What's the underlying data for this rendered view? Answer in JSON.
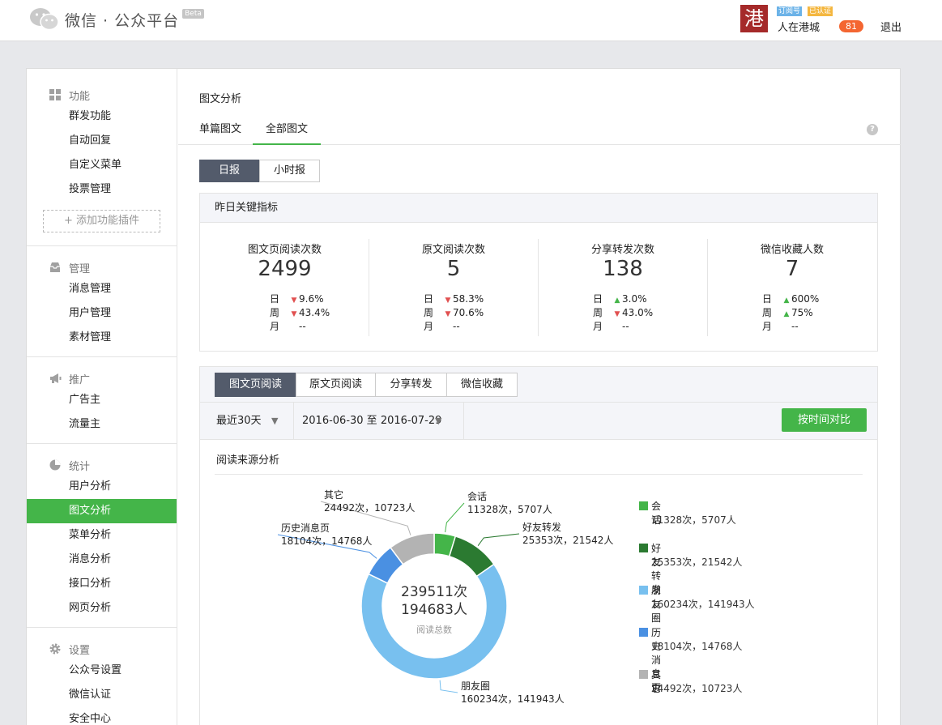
{
  "header": {
    "logo_text": "微信 · 公众平台",
    "beta": "Beta",
    "avatar_char": "港",
    "tag_subscription": "订阅号",
    "tag_certified": "已认证",
    "account_name": "人在港城",
    "notify_count": "81",
    "logout": "退出"
  },
  "sidebar": {
    "groups": [
      {
        "title": "功能",
        "icon": "grid-icon",
        "items": [
          "群发功能",
          "自动回复",
          "自定义菜单",
          "投票管理"
        ],
        "add_plugin": "+ 添加功能插件"
      },
      {
        "title": "管理",
        "icon": "inbox-icon",
        "items": [
          "消息管理",
          "用户管理",
          "素材管理"
        ]
      },
      {
        "title": "推广",
        "icon": "megaphone-icon",
        "items": [
          "广告主",
          "流量主"
        ]
      },
      {
        "title": "统计",
        "icon": "pie-icon",
        "items": [
          "用户分析",
          "图文分析",
          "菜单分析",
          "消息分析",
          "接口分析",
          "网页分析"
        ],
        "active_index": 1
      },
      {
        "title": "设置",
        "icon": "gear-icon",
        "items": [
          "公众号设置",
          "微信认证",
          "安全中心"
        ]
      }
    ]
  },
  "main": {
    "title": "图文分析",
    "tabs": [
      "单篇图文",
      "全部图文"
    ],
    "active_tab": 1,
    "report_types": [
      "日报",
      "小时报"
    ],
    "key_metrics": {
      "title": "昨日关键指标",
      "row_labels": [
        "日",
        "周",
        "月"
      ],
      "columns": [
        {
          "label": "图文页阅读次数",
          "value": "2499",
          "day": "9.6%",
          "day_dir": "down",
          "week": "43.4%",
          "week_dir": "down",
          "month": "--"
        },
        {
          "label": "原文阅读次数",
          "value": "5",
          "day": "58.3%",
          "day_dir": "down",
          "week": "70.6%",
          "week_dir": "down",
          "month": "--"
        },
        {
          "label": "分享转发次数",
          "value": "138",
          "day": "3.0%",
          "day_dir": "up",
          "week": "43.0%",
          "week_dir": "down",
          "month": "--"
        },
        {
          "label": "微信收藏人数",
          "value": "7",
          "day": "600%",
          "day_dir": "up",
          "week": "75%",
          "week_dir": "up",
          "month": "--"
        }
      ]
    },
    "chart_tabs": [
      "图文页阅读",
      "原文页阅读",
      "分享转发",
      "微信收藏"
    ],
    "filter": {
      "range": "最近30天",
      "dates": "2016-06-30 至 2016-07-29",
      "compare_button": "按时间对比"
    },
    "source_title": "阅读来源分析"
  },
  "chart_data": {
    "type": "pie",
    "donut": true,
    "center_total_count": "239511次",
    "center_total_people": "194683人",
    "center_label": "阅读总数",
    "categories": [
      "会话",
      "好友转发",
      "朋友圈",
      "历史消息页",
      "其它"
    ],
    "values": [
      11328,
      25353,
      160234,
      18104,
      24492
    ],
    "people": [
      5707,
      21542,
      141943,
      14768,
      10723
    ],
    "value_labels": [
      "11328次，5707人",
      "25353次，21542人",
      "160234次，141943人",
      "18104次，14768人",
      "24492次，10723人"
    ],
    "colors": [
      "#44b549",
      "#2b7a31",
      "#78c0ef",
      "#4a90e2",
      "#b3b3b3"
    ],
    "legend_position": "right"
  }
}
